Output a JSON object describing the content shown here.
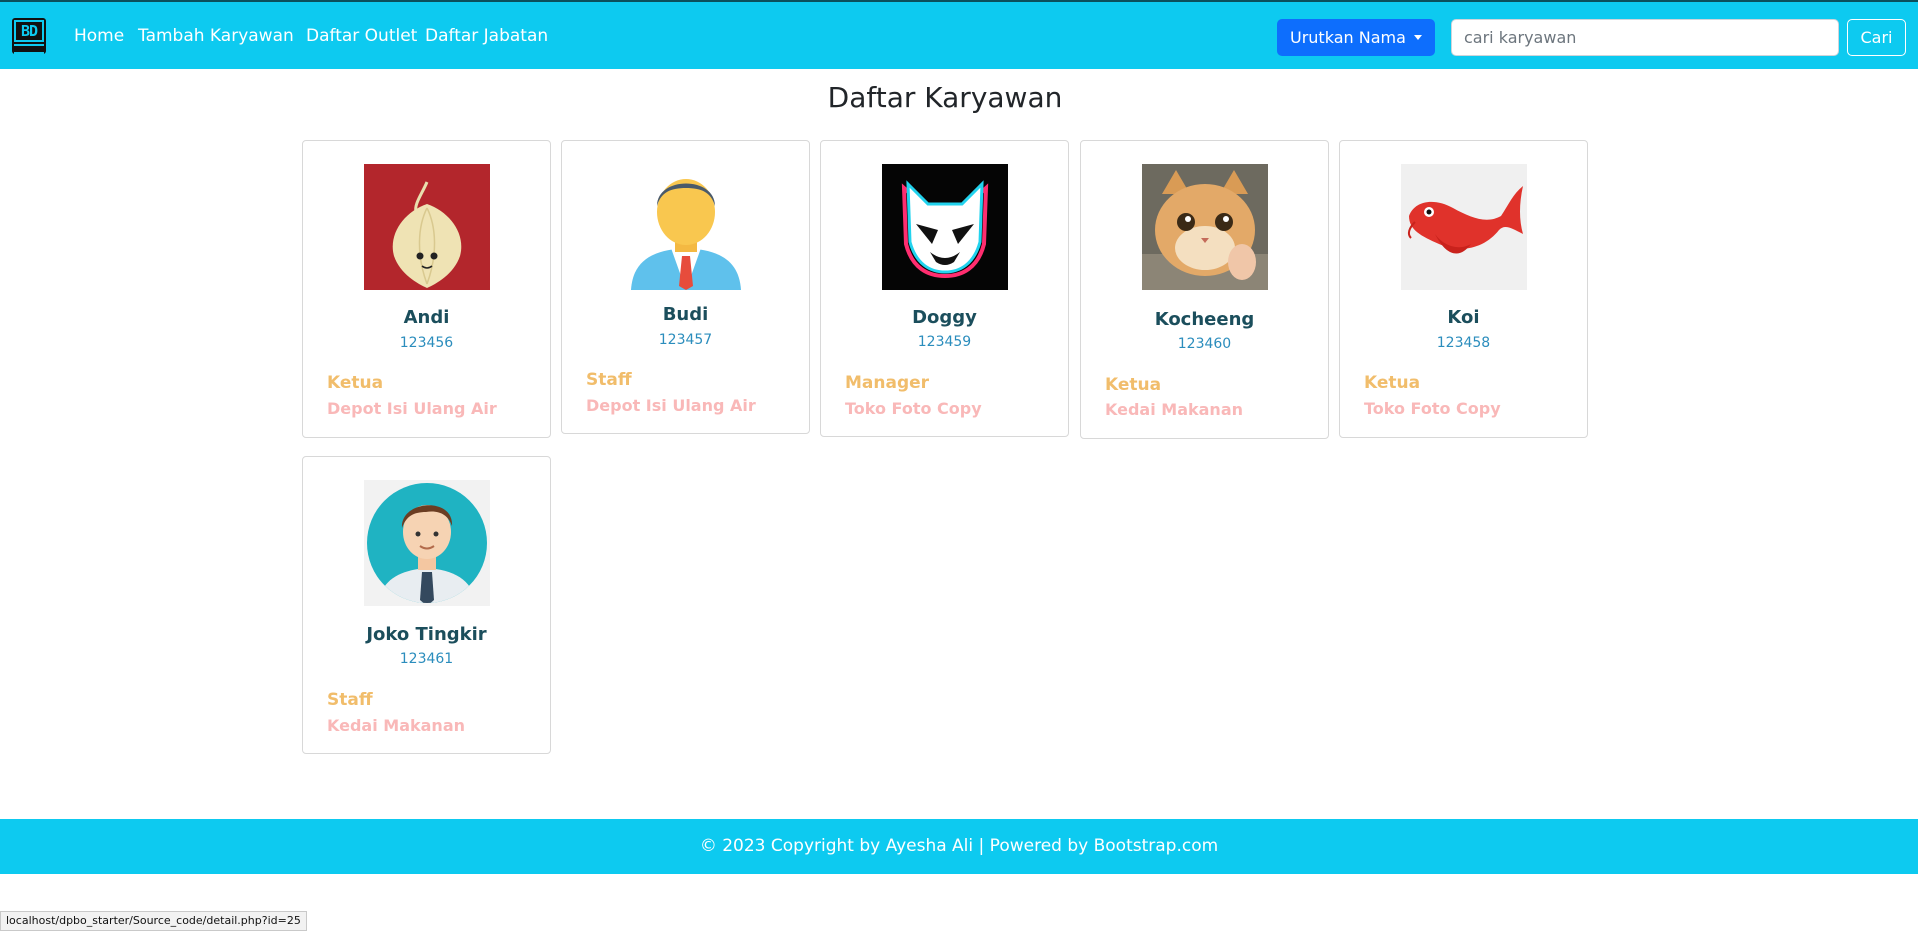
{
  "navbar": {
    "brand": "BD",
    "links": [
      "Home",
      "Tambah Karyawan",
      "Daftar Outlet",
      "Daftar Jabatan"
    ],
    "sort_label": "Urutkan Nama",
    "search_placeholder": "cari karyawan",
    "search_button": "Cari"
  },
  "page": {
    "title": "Daftar Karyawan"
  },
  "employees": [
    {
      "name": "Andi",
      "id": "123456",
      "role": "Ketua",
      "outlet": "Depot Isi Ulang Air",
      "image": "onion-character-image"
    },
    {
      "name": "Budi",
      "id": "123457",
      "role": "Staff",
      "outlet": "Depot Isi Ulang Air",
      "image": "businessman-avatar-image"
    },
    {
      "name": "Doggy",
      "id": "123459",
      "role": "Manager",
      "outlet": "Toko Foto Copy",
      "image": "neon-cat-mask-image"
    },
    {
      "name": "Kocheeng",
      "id": "123460",
      "role": "Ketua",
      "outlet": "Kedai Makanan",
      "image": "cat-photo-image"
    },
    {
      "name": "Koi",
      "id": "123458",
      "role": "Ketua",
      "outlet": "Toko Foto Copy",
      "image": "koi-fish-image"
    },
    {
      "name": "Joko Tingkir",
      "id": "123461",
      "role": "Staff",
      "outlet": "Kedai Makanan",
      "image": "man-circle-avatar-image"
    }
  ],
  "footer": {
    "text": "© 2023 Copyright by Ayesha Ali  |  Powered by Bootstrap.com"
  },
  "statusbar": {
    "url": "localhost/dpbo_starter/Source_code/detail.php?id=25"
  }
}
